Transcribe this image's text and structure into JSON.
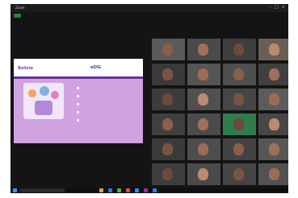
{
  "window": {
    "title": "Zoom",
    "controls": [
      "minimize-icon",
      "maximize-icon",
      "close-icon"
    ]
  },
  "slide": {
    "brand_left": "Bolivia",
    "brand_right": "eSIG",
    "heading": "",
    "bullets": [
      "",
      "",
      "",
      "",
      ""
    ]
  },
  "participants": [
    {
      "label": ""
    },
    {
      "label": ""
    },
    {
      "label": ""
    },
    {
      "label": ""
    },
    {
      "label": ""
    },
    {
      "label": ""
    },
    {
      "label": ""
    },
    {
      "label": ""
    },
    {
      "label": ""
    },
    {
      "label": ""
    },
    {
      "label": ""
    },
    {
      "label": ""
    },
    {
      "label": ""
    },
    {
      "label": ""
    },
    {
      "label": ""
    },
    {
      "label": ""
    },
    {
      "label": ""
    },
    {
      "label": ""
    },
    {
      "label": ""
    },
    {
      "label": ""
    },
    {
      "label": ""
    },
    {
      "label": ""
    },
    {
      "label": ""
    },
    {
      "label": ""
    }
  ],
  "taskbar": {
    "search_placeholder": "",
    "clock": ""
  },
  "colors": {
    "slide_purple": "#cfa3e0",
    "slide_band": "#6b2f9b",
    "screen_bg": "#141414"
  }
}
